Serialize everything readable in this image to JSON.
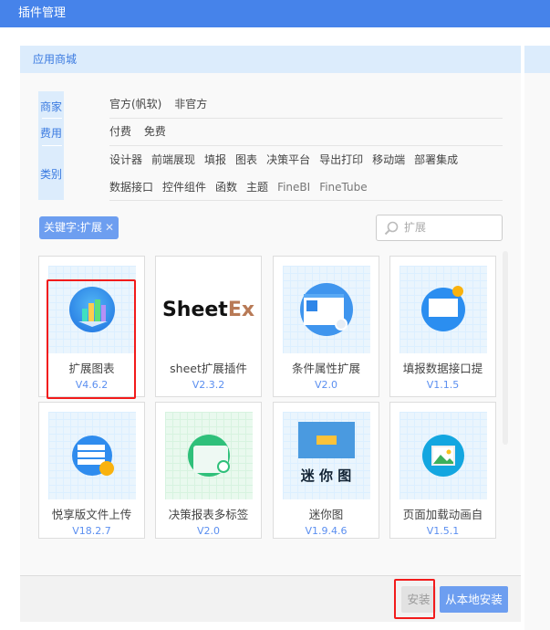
{
  "title": "插件管理",
  "store": {
    "header": "应用商城"
  },
  "filters": {
    "vendor": {
      "label": "商家",
      "options": [
        "官方(帆软)",
        "非官方"
      ]
    },
    "fee": {
      "label": "费用",
      "options": [
        "付费",
        "免费"
      ]
    },
    "category": {
      "label": "类别",
      "options": [
        "设计器",
        "前端展现",
        "填报",
        "图表",
        "决策平台",
        "导出打印",
        "移动端",
        "部署集成",
        "数据接口",
        "控件组件",
        "函数",
        "主题",
        "FineBI",
        "FineTube"
      ]
    }
  },
  "keyword_tag": {
    "label": "关键字:扩展",
    "close": "✕"
  },
  "search": {
    "value": "扩展"
  },
  "plugins": [
    {
      "name": "扩展图表",
      "version": "V4.6.2",
      "icon": "chart-icon"
    },
    {
      "name": "sheet扩展插件",
      "version": "V2.3.2",
      "icon": "sheetex-logo",
      "logo_text": "SheetEx"
    },
    {
      "name": "条件属性扩展",
      "version": "V2.0",
      "icon": "form-icon"
    },
    {
      "name": "填报数据接口提",
      "version": "V1.1.5",
      "icon": "presentation-icon"
    },
    {
      "name": "悦享版文件上传",
      "version": "V18.2.7",
      "icon": "upload-icon"
    },
    {
      "name": "决策报表多标签",
      "version": "V2.0",
      "icon": "folder-icon"
    },
    {
      "name": "迷你图",
      "version": "V1.9.4.6",
      "icon": "mini-chart-icon",
      "image_text": "迷 你 图"
    },
    {
      "name": "页面加载动画自",
      "version": "V1.5.1",
      "icon": "image-icon"
    }
  ],
  "buttons": {
    "install": "安装",
    "install_local": "从本地安装"
  }
}
